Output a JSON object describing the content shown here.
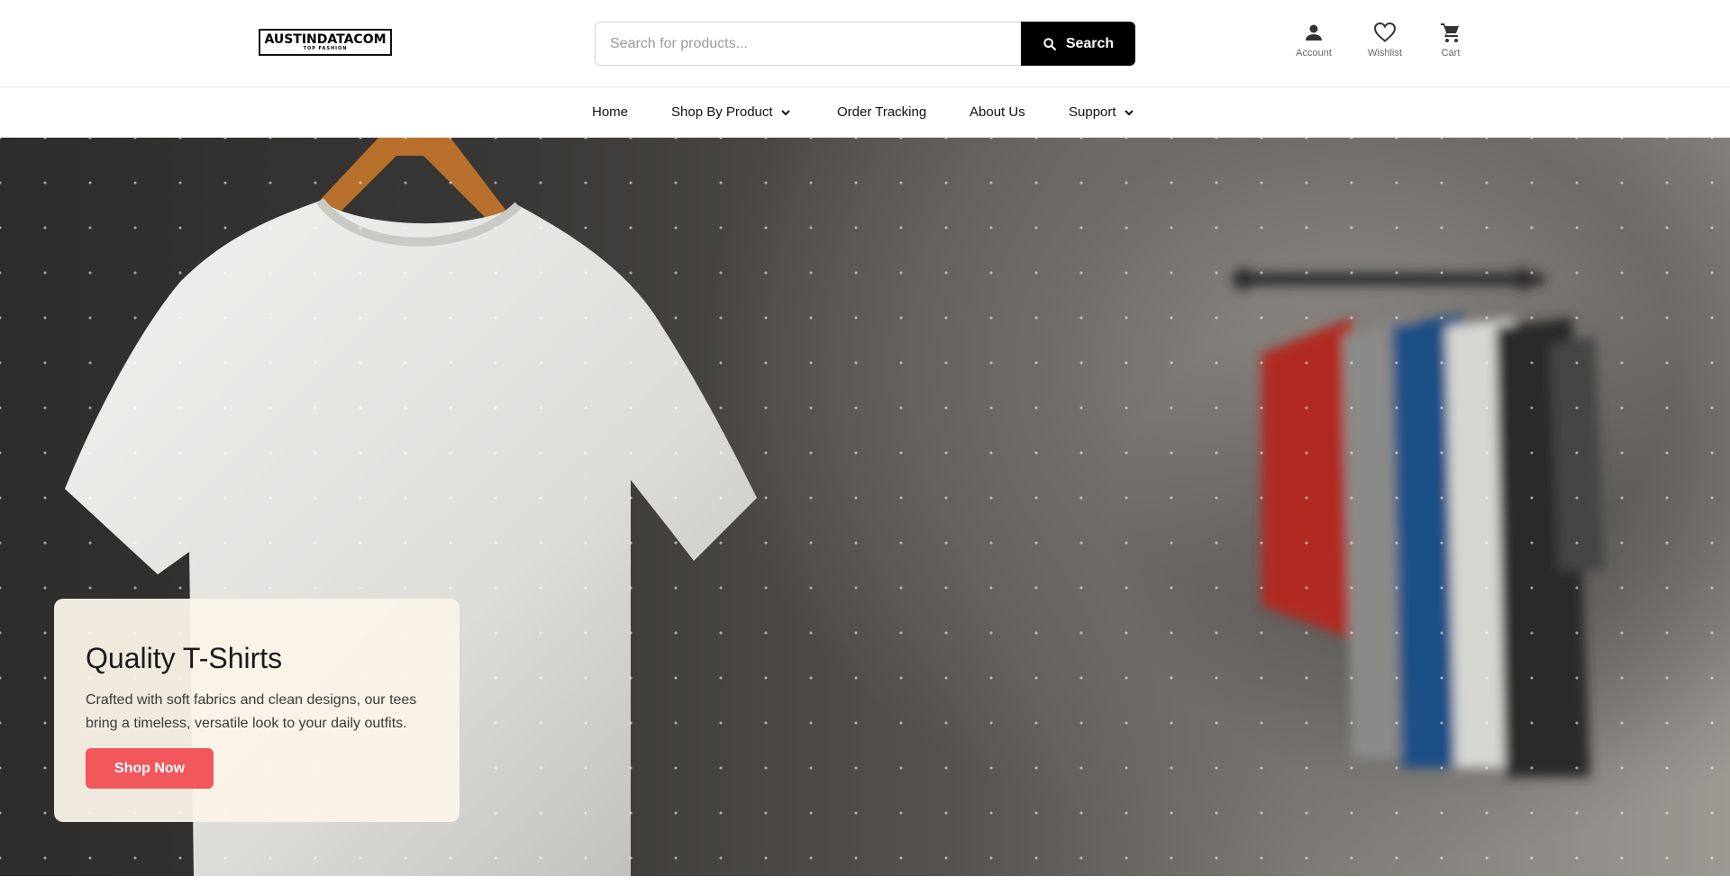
{
  "header": {
    "logo": {
      "main": "AUSTINDATACOM",
      "sub": "TOP FASHION"
    },
    "search": {
      "placeholder": "Search for products...",
      "button_label": "Search"
    },
    "icons": [
      {
        "name": "account-icon",
        "label": "Account"
      },
      {
        "name": "heart-icon",
        "label": "Wishlist"
      },
      {
        "name": "cart-icon",
        "label": "Cart"
      }
    ]
  },
  "nav": {
    "items": [
      {
        "label": "Home",
        "has_dropdown": false
      },
      {
        "label": "Shop By Product",
        "has_dropdown": true
      },
      {
        "label": "Order Tracking",
        "has_dropdown": false
      },
      {
        "label": "About Us",
        "has_dropdown": false
      },
      {
        "label": "Support",
        "has_dropdown": true
      }
    ]
  },
  "hero": {
    "title": "Quality T-Shirts",
    "description": "Crafted with soft fabrics and clean designs, our tees bring a timeless, versatile look to your daily outfits.",
    "button_label": "Shop Now"
  },
  "colors": {
    "primary": "#000000",
    "accent": "#f2575b",
    "promo_bg": "#faf3e8"
  }
}
